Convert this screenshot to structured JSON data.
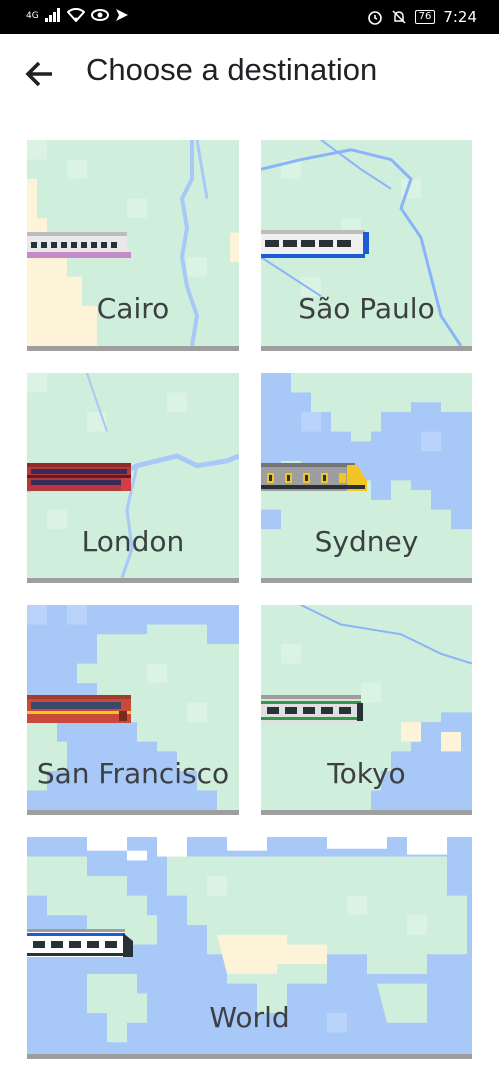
{
  "status_bar": {
    "network": "4G",
    "icons": [
      "signal-icon",
      "wifi-icon",
      "eye-icon",
      "send-icon"
    ],
    "right_icons": [
      "alarm-icon",
      "notifications-off-icon"
    ],
    "battery": "76",
    "time": "7:24"
  },
  "header": {
    "back_icon": "arrow-back-icon",
    "title": "Choose a destination"
  },
  "destinations": [
    {
      "label": "Cairo"
    },
    {
      "label": "São Paulo"
    },
    {
      "label": "London"
    },
    {
      "label": "Sydney"
    },
    {
      "label": "San Francisco"
    },
    {
      "label": "Tokyo"
    },
    {
      "label": "World"
    }
  ],
  "colors": {
    "land": "#cfeedb",
    "land_alt": "#daf3e3",
    "water": "#a8c8f8",
    "water_alt": "#b9d3fb",
    "river": "#8ab4f8",
    "sand": "#fdf3d8",
    "tile_border": "#9e9e9e",
    "title_text": "#202124"
  }
}
